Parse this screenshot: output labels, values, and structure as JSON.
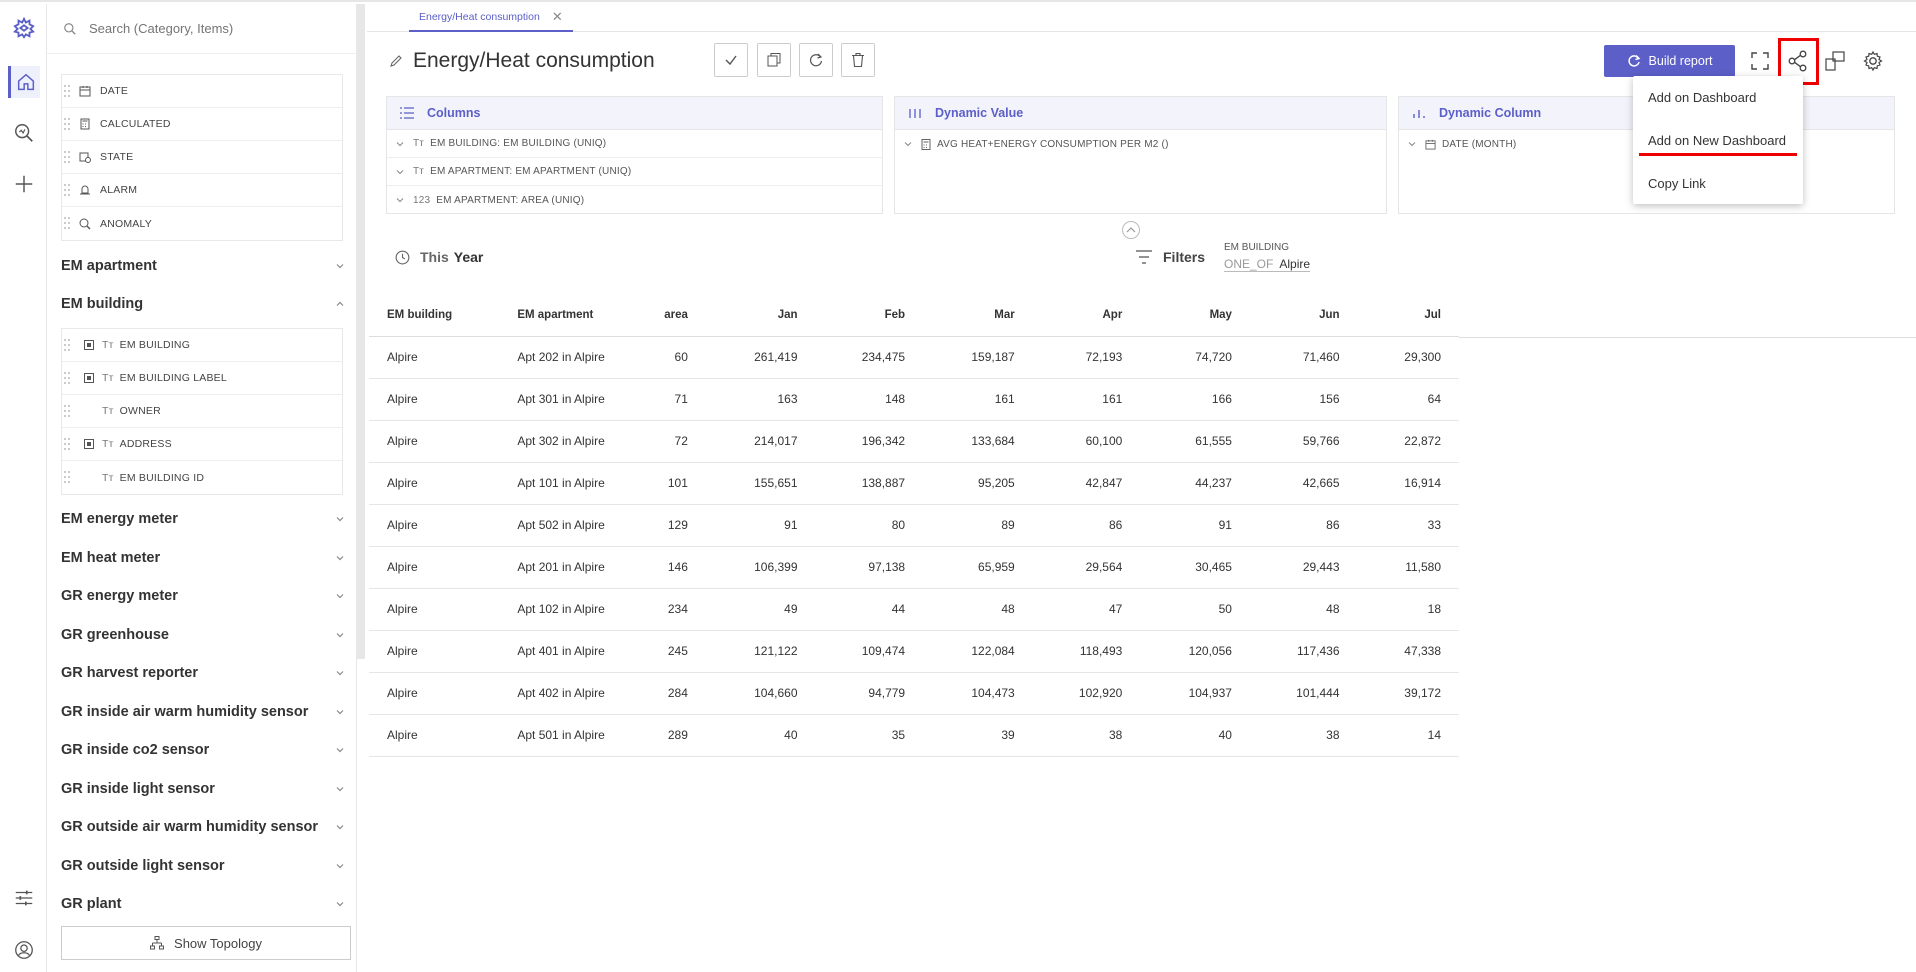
{
  "search": {
    "placeholder": "Search (Category, Items)"
  },
  "fields_top": [
    {
      "label": "DATE",
      "icon": "calendar-icon"
    },
    {
      "label": "CALCULATED",
      "icon": "calculator-icon"
    },
    {
      "label": "STATE",
      "icon": "state-icon"
    },
    {
      "label": "ALARM",
      "icon": "alarm-icon"
    },
    {
      "label": "ANOMALY",
      "icon": "anomaly-icon"
    }
  ],
  "groups": [
    "EM apartment",
    "EM building",
    "EM energy meter",
    "EM heat meter",
    "GR energy meter",
    "GR greenhouse",
    "GR harvest reporter",
    "GR inside air warm humidity sensor",
    "GR inside co2 sensor",
    "GR inside light sensor",
    "GR outside air warm humidity sensor",
    "GR outside light sensor",
    "GR plant"
  ],
  "em_building_fields": [
    "EM BUILDING",
    "EM BUILDING LABEL",
    "OWNER",
    "ADDRESS",
    "EM BUILDING ID"
  ],
  "topology_label": "Show Topology",
  "tab": {
    "label": "Energy/Heat consumption"
  },
  "title": "Energy/Heat consumption",
  "build_label": "Build report",
  "panels": {
    "columns": {
      "title": "Columns",
      "items": [
        "EM BUILDING: EM BUILDING (UNIQ)",
        "EM APARTMENT: EM APARTMENT (UNIQ)",
        "EM APARTMENT: AREA (UNIQ)"
      ],
      "types": [
        "Tт",
        "Tт",
        "123"
      ]
    },
    "dynamic_value": {
      "title": "Dynamic Value",
      "items": [
        "AVG HEAT+ENERGY CONSUMPTION PER M2 ()"
      ]
    },
    "dynamic_column": {
      "title": "Dynamic Column",
      "items": [
        "DATE (MONTH)"
      ]
    }
  },
  "period": {
    "label": "This",
    "value": "Year"
  },
  "filters": {
    "label": "Filters",
    "field": "EM BUILDING",
    "op": "ONE_OF",
    "value": "Alpire"
  },
  "table": {
    "headers": [
      "EM building",
      "EM apartment",
      "area",
      "Jan",
      "Feb",
      "Mar",
      "Apr",
      "May",
      "Jun",
      "Jul"
    ],
    "rows": [
      [
        "Alpire",
        "Apt 202 in Alpire",
        "60",
        "261,419",
        "234,475",
        "159,187",
        "72,193",
        "74,720",
        "71,460",
        "29,300"
      ],
      [
        "Alpire",
        "Apt 301 in Alpire",
        "71",
        "163",
        "148",
        "161",
        "161",
        "166",
        "156",
        "64"
      ],
      [
        "Alpire",
        "Apt 302 in Alpire",
        "72",
        "214,017",
        "196,342",
        "133,684",
        "60,100",
        "61,555",
        "59,766",
        "22,872"
      ],
      [
        "Alpire",
        "Apt 101 in Alpire",
        "101",
        "155,651",
        "138,887",
        "95,205",
        "42,847",
        "44,237",
        "42,665",
        "16,914"
      ],
      [
        "Alpire",
        "Apt 502 in Alpire",
        "129",
        "91",
        "80",
        "89",
        "86",
        "91",
        "86",
        "33"
      ],
      [
        "Alpire",
        "Apt 201 in Alpire",
        "146",
        "106,399",
        "97,138",
        "65,959",
        "29,564",
        "30,465",
        "29,443",
        "11,580"
      ],
      [
        "Alpire",
        "Apt 102 in Alpire",
        "234",
        "49",
        "44",
        "48",
        "47",
        "50",
        "48",
        "18"
      ],
      [
        "Alpire",
        "Apt 401 in Alpire",
        "245",
        "121,122",
        "109,474",
        "122,084",
        "118,493",
        "120,056",
        "117,436",
        "47,338"
      ],
      [
        "Alpire",
        "Apt 402 in Alpire",
        "284",
        "104,660",
        "94,779",
        "104,473",
        "102,920",
        "104,937",
        "101,444",
        "39,172"
      ],
      [
        "Alpire",
        "Apt 501 in Alpire",
        "289",
        "40",
        "35",
        "39",
        "38",
        "40",
        "38",
        "14"
      ]
    ]
  },
  "share_menu": [
    "Add on Dashboard",
    "Add on New Dashboard",
    "Copy Link"
  ],
  "colors": {
    "accent": "#5b5fc7",
    "highlight": "#ee0000"
  }
}
